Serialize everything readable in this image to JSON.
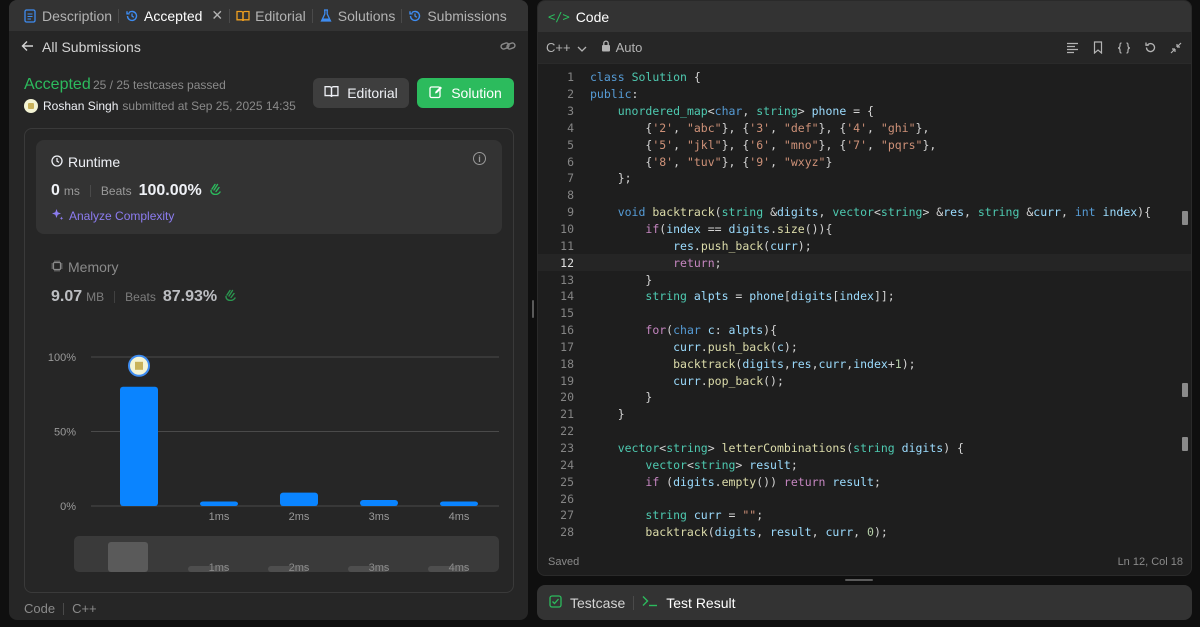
{
  "left_tabs": [
    {
      "label": "Description",
      "icon": "document-icon"
    },
    {
      "label": "Accepted",
      "icon": "history-icon"
    },
    {
      "label": "Editorial",
      "icon": "book-icon"
    },
    {
      "label": "Solutions",
      "icon": "flask-icon"
    },
    {
      "label": "Submissions",
      "icon": "history-icon"
    }
  ],
  "close_glyph": "✕",
  "subheader": {
    "back_label": "All Submissions"
  },
  "result": {
    "status": "Accepted",
    "testcases": "25 / 25 testcases passed",
    "user": "Roshan Singh",
    "submitted_text": "submitted at Sep 25, 2025 14:35"
  },
  "buttons": {
    "editorial": "Editorial",
    "solution": "Solution"
  },
  "runtime": {
    "title": "Runtime",
    "value": "0",
    "unit": "ms",
    "beats_label": "Beats",
    "beats": "100.00%",
    "analyze": "Analyze Complexity"
  },
  "memory": {
    "title": "Memory",
    "value": "9.07",
    "unit": "MB",
    "beats_label": "Beats",
    "beats": "87.93%"
  },
  "chart_data": {
    "type": "bar",
    "categories": [
      "0ms",
      "1ms",
      "2ms",
      "3ms",
      "4ms"
    ],
    "x_tick_labels": [
      "",
      "1ms",
      "2ms",
      "3ms",
      "4ms"
    ],
    "values": [
      80,
      3,
      9,
      4,
      3
    ],
    "y_tick_labels": [
      "100%",
      "50%",
      "0%"
    ],
    "ylim": [
      0,
      100
    ],
    "highlight_index": 0,
    "grid": true,
    "bar_color": "#0a84ff",
    "minimap_values": [
      25,
      3,
      3,
      3,
      3
    ]
  },
  "footer": {
    "code_label": "Code",
    "lang": "C++"
  },
  "code_panel": {
    "title": "Code"
  },
  "toolbar": {
    "language": "C++",
    "mode": "Auto"
  },
  "code_lines": [
    "class Solution {",
    "public:",
    "    unordered_map<char, string> phone = {",
    "        {'2', \"abc\"}, {'3', \"def\"}, {'4', \"ghi\"},",
    "        {'5', \"jkl\"}, {'6', \"mno\"}, {'7', \"pqrs\"},",
    "        {'8', \"tuv\"}, {'9', \"wxyz\"}",
    "    };",
    "",
    "    void backtrack(string &digits, vector<string> &res, string &curr, int index){",
    "        if(index == digits.size()){",
    "            res.push_back(curr);",
    "            return;",
    "        }",
    "        string alpts = phone[digits[index]];",
    "",
    "        for(char c: alpts){",
    "            curr.push_back(c);",
    "            backtrack(digits,res,curr,index+1);",
    "            curr.pop_back();",
    "        }",
    "    }",
    "",
    "    vector<string> letterCombinations(string digits) {",
    "        vector<string> result;",
    "        if (digits.empty()) return result;",
    "",
    "        string curr = \"\";",
    "        backtrack(digits, result, curr, 0);"
  ],
  "current_line": 12,
  "editor_status": {
    "saved": "Saved",
    "position": "Ln 12, Col 18"
  },
  "bottom_tabs": {
    "testcase": "Testcase",
    "test_result": "Test Result"
  },
  "colors": {
    "accepted_green": "#2cbb5d",
    "keyword_blue": "#569cd6",
    "type_teal": "#4ec9b0",
    "function_yellow": "#dcdcaa",
    "string_orange": "#ce9178",
    "control_purple": "#c586c0",
    "variable_lightblue": "#9cdcfe",
    "number_green": "#b5cea8",
    "bar_blue": "#0a84ff"
  }
}
